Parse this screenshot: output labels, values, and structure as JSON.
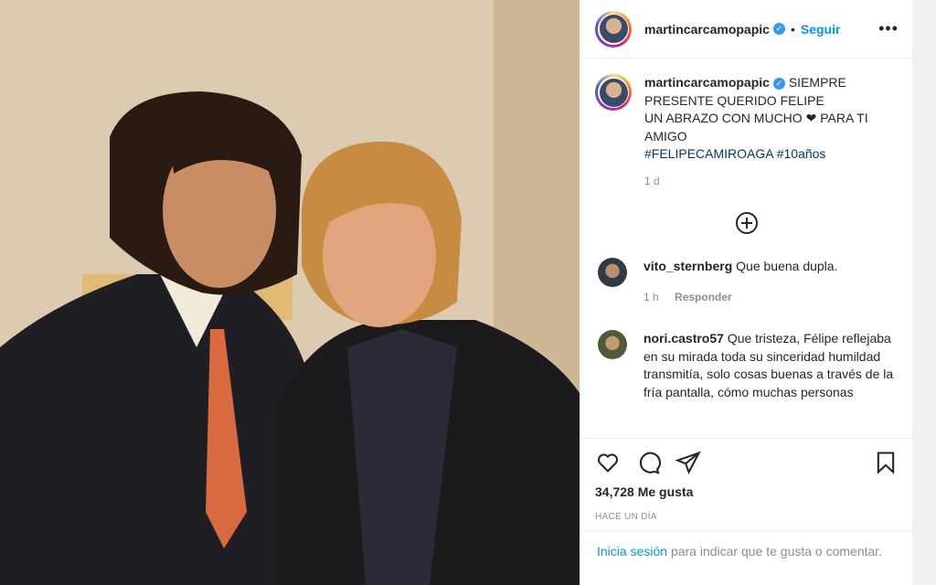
{
  "post": {
    "username": "martincarcamopapic",
    "follow_label": "Seguir",
    "more_label": "•••",
    "separator": "•"
  },
  "caption": {
    "username": "martincarcamopapic",
    "line1": "SIEMPRE PRESENTE QUERIDO FELIPE",
    "line2": "UN ABRAZO CON MUCHO",
    "heart": "❤",
    "line2b": "PARA TI AMIGO",
    "hashtags": "#FELIPECAMIROAGA #10años",
    "time": "1 d"
  },
  "comments": [
    {
      "username": "vito_sternberg",
      "text": "Que buena dupla.",
      "time": "1 h",
      "reply": "Responder"
    },
    {
      "username": "nori.castro57",
      "text": "Que tristeza, Félipe reflejaba en su mirada toda su sinceridad humildad transmitía, solo cosas buenas a través de la fría pantalla, cómo muchas personas"
    }
  ],
  "likes": {
    "count": "34,728",
    "label": "Me gusta"
  },
  "ago": "HACE UN DÍA",
  "login": {
    "link": "Inicia sesión",
    "text": "para indicar que te gusta o comentar."
  },
  "colors": {
    "link": "#0095f6",
    "hashtag": "#00376b",
    "muted": "#8e8e8e",
    "verified": "#3897f0"
  }
}
